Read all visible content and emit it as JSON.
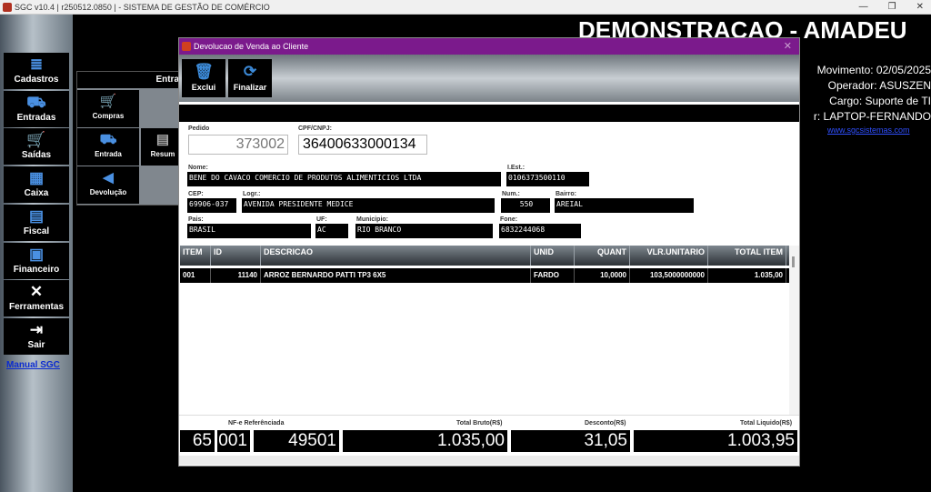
{
  "window": {
    "title": "SGC v10.4 | r250512.0850 | - SISTEMA DE GESTÃO DE COMÉRCIO",
    "minimize": "—",
    "restore": "❐",
    "close": "✕"
  },
  "sidebar": {
    "items": [
      {
        "label": "Cadastros",
        "icon": "≣"
      },
      {
        "label": "Entradas",
        "icon": "⛟"
      },
      {
        "label": "Saídas",
        "icon": "🛒"
      },
      {
        "label": "Caixa",
        "icon": "▦"
      },
      {
        "label": "Fiscal",
        "icon": "▤"
      },
      {
        "label": "Financeiro",
        "icon": "▣"
      },
      {
        "label": "Ferramentas",
        "icon": "✕"
      },
      {
        "label": "Sair",
        "icon": "⇥"
      }
    ],
    "manual": "Manual SGC"
  },
  "subpanel": {
    "header": "Entra",
    "items": [
      {
        "label": "Compras",
        "icon": "🛒"
      },
      {
        "label": "Entrada",
        "icon": "⛟"
      },
      {
        "label": "Resum",
        "icon": "▤"
      },
      {
        "label": "Devolução",
        "icon": "◀"
      }
    ]
  },
  "background": {
    "title": "DEMONSTRACAO - AMADEU",
    "movimento": "Movimento: 02/05/2025",
    "operador": "Operador: ASUSZEN",
    "cargo": "Cargo: Suporte de TI",
    "computador": "r: LAPTOP-FERNANDO",
    "link": "www.sgcsistemas.com"
  },
  "modal": {
    "title": "Devolucao de Venda ao Cliente",
    "close": "✕",
    "toolbar": {
      "excluir": "Exclui",
      "finalizar": "Finalizar"
    },
    "fields": {
      "pedido_label": "Pedido",
      "pedido": "373002",
      "cpf_label": "CPF/CNPJ:",
      "cpf": "36400633000134",
      "nome_label": "Nome:",
      "nome": "BENE DO CAVACO COMERCIO DE PRODUTOS ALIMENTICIOS LTDA",
      "iest_label": "I.Est.:",
      "iest": "0106373500110",
      "cep_label": "CEP:",
      "cep": "69906-037",
      "logr_label": "Logr.:",
      "logr": "AVENIDA PRESIDENTE MEDICE",
      "num_label": "Num.:",
      "num": "550",
      "bairro_label": "Bairro:",
      "bairro": "AREIAL",
      "pais_label": "Pais:",
      "pais": "BRASIL",
      "uf_label": "UF:",
      "uf": "AC",
      "municipio_label": "Municipio:",
      "municipio": "RIO BRANCO",
      "fone_label": "Fone:",
      "fone": "6832244068"
    },
    "table": {
      "headers": [
        "ITEM",
        "ID",
        "DESCRICAO",
        "UNID",
        "QUANT",
        "VLR.UNITARIO",
        "TOTAL ITEM"
      ],
      "rows": [
        {
          "item": "001",
          "id": "11140",
          "descricao": "ARROZ BERNARDO PATTI TP3 6X5",
          "unid": "FARDO",
          "quant": "10,0000",
          "vlr": "103,5000000000",
          "total": "1.035,00"
        }
      ]
    },
    "footer": {
      "nfe_label": "NF-e Referênciada",
      "nfe_a": "65",
      "nfe_b": "001",
      "nfe_c": "49501",
      "bruto_label": "Total Bruto(R$)",
      "bruto": "1.035,00",
      "desconto_label": "Desconto(R$)",
      "desconto": "31,05",
      "liquido_label": "Total Liquido(R$)",
      "liquido": "1.003,95"
    }
  }
}
